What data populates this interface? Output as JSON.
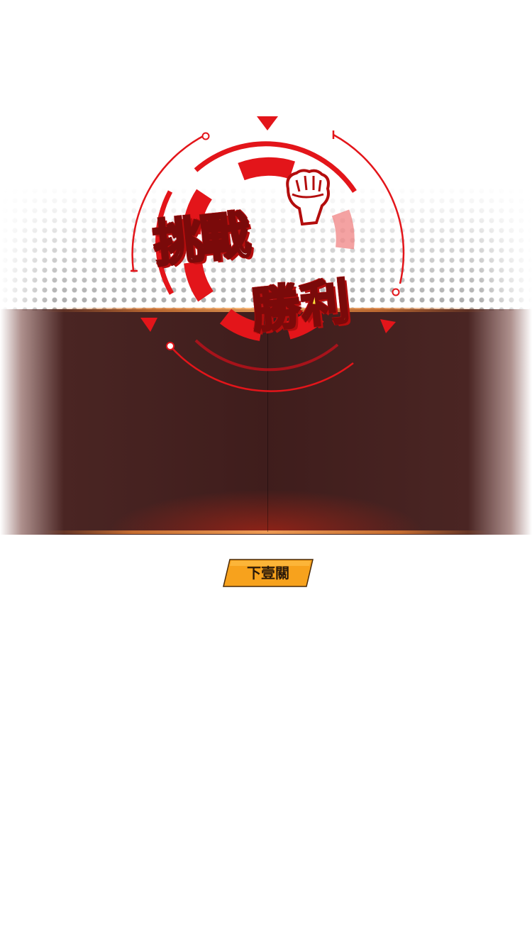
{
  "banner": {
    "title_line1": "挑戰",
    "title_line2": "勝利"
  },
  "actions": {
    "next_level_label": "下壹關"
  },
  "colors": {
    "accent_red": "#e3151a",
    "title_yellow": "#ffe23a",
    "button_orange": "#f7a21d",
    "panel_dark": "#3f1d1c"
  },
  "icons": {
    "emblem": "fist-icon"
  }
}
